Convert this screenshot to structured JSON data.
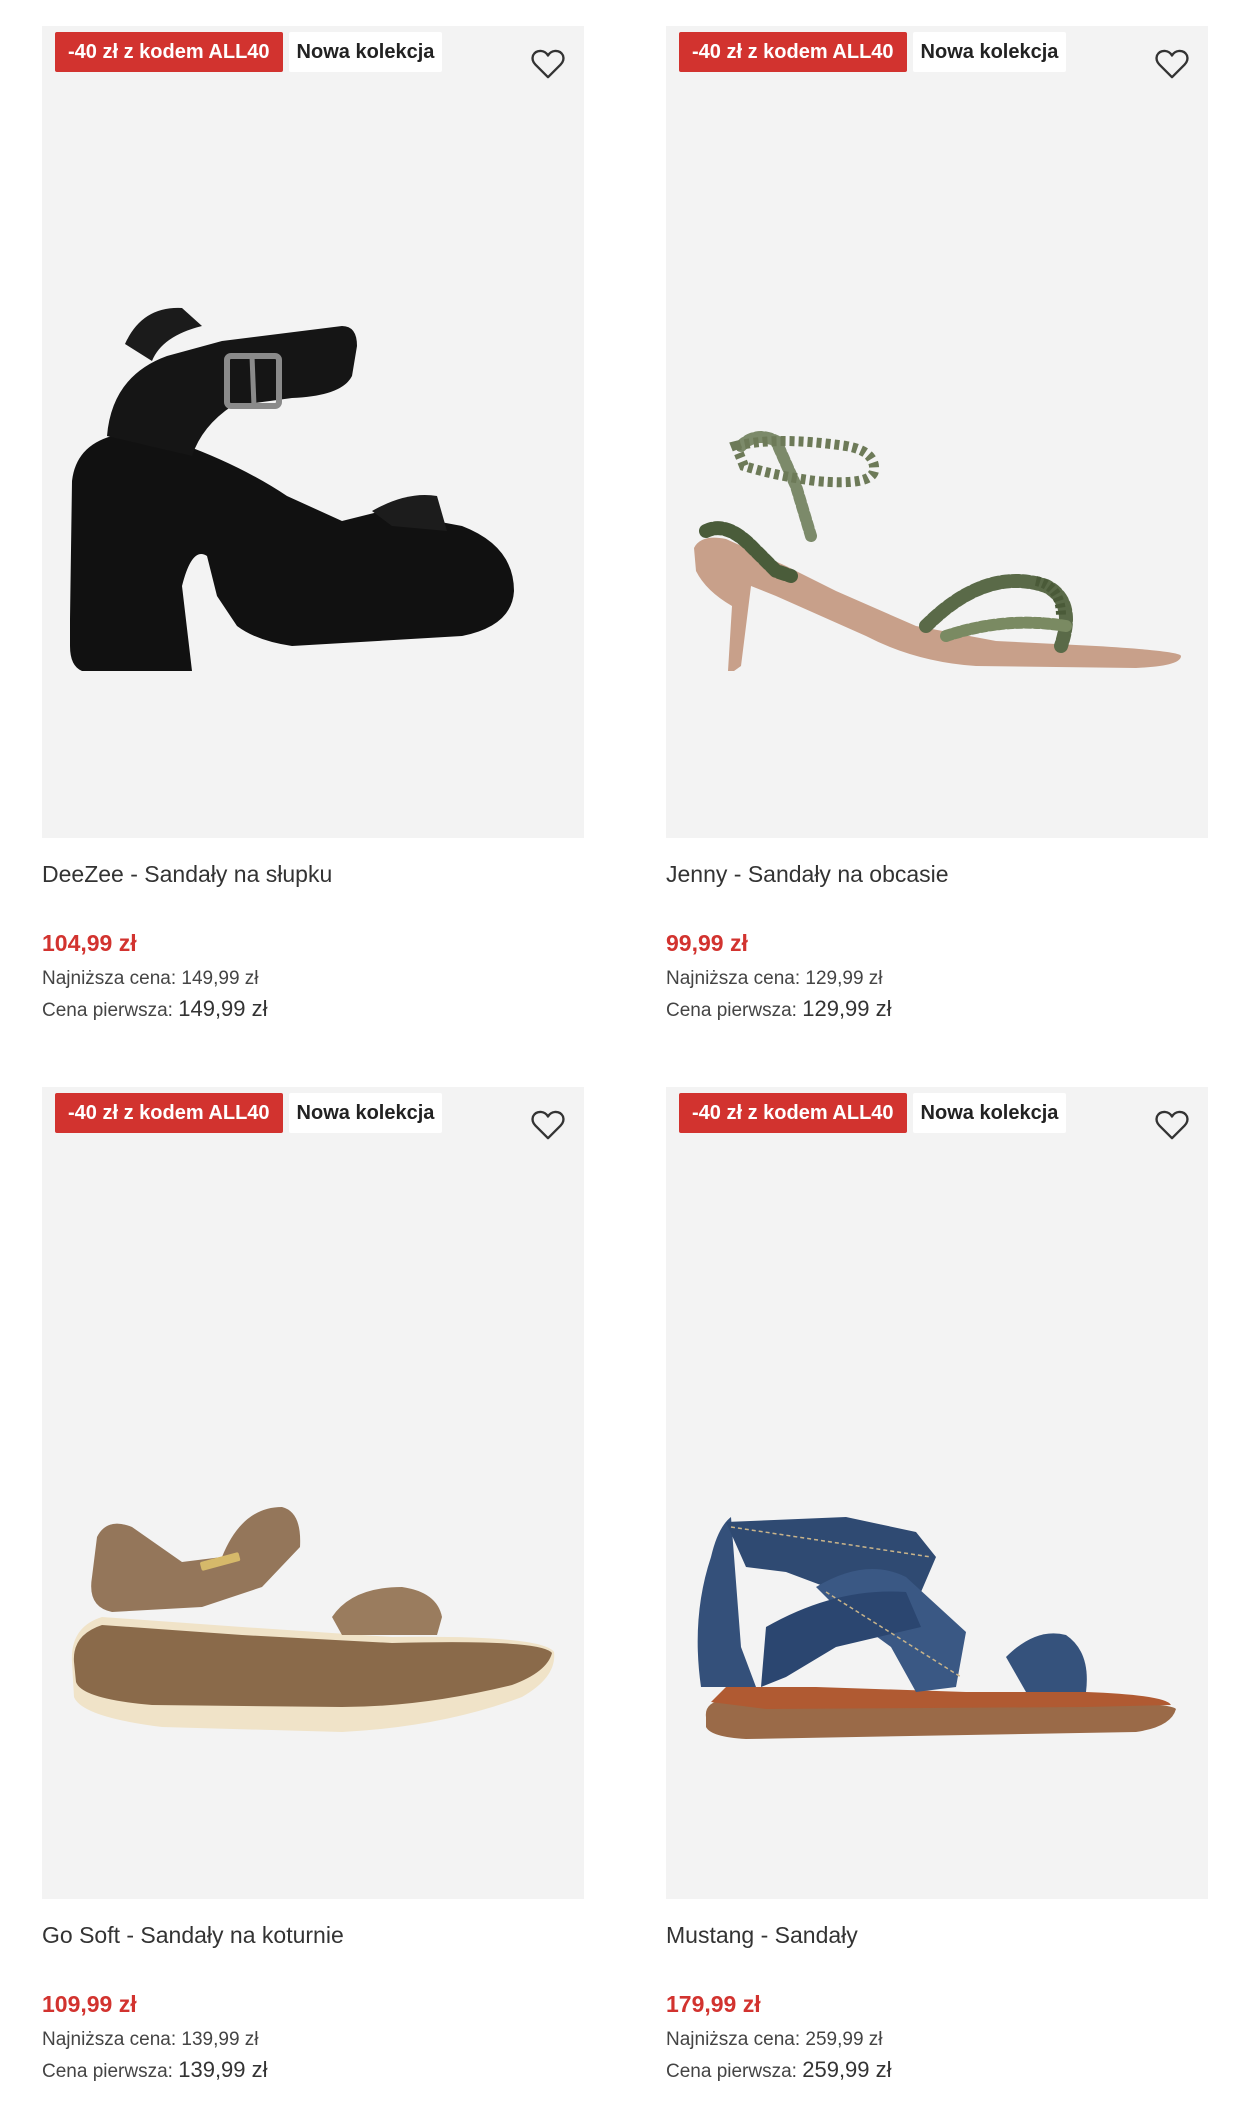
{
  "products": [
    {
      "promo_badge": "-40 zł z kodem ALL40",
      "new_badge": "Nowa kolekcja",
      "title": "DeeZee - Sandały na słupku",
      "price": "104,99 zł",
      "lowest_label": "Najniższa cena:",
      "lowest_value": "149,99 zł",
      "first_label": "Cena pierwsza:",
      "first_value": "149,99 zł",
      "image_icon": "black-platform-sandal"
    },
    {
      "promo_badge": "-40 zł z kodem ALL40",
      "new_badge": "Nowa kolekcja",
      "title": "Jenny - Sandały na obcasie",
      "price": "99,99 zł",
      "lowest_label": "Najniższa cena:",
      "lowest_value": "129,99 zł",
      "first_label": "Cena pierwsza:",
      "first_value": "129,99 zł",
      "image_icon": "snakeskin-kitten-heel-sandal"
    },
    {
      "promo_badge": "-40 zł z kodem ALL40",
      "new_badge": "Nowa kolekcja",
      "title": "Go Soft - Sandały na koturnie",
      "price": "109,99 zł",
      "lowest_label": "Najniższa cena:",
      "lowest_value": "139,99 zł",
      "first_label": "Cena pierwsza:",
      "first_value": "139,99 zł",
      "image_icon": "brown-wedge-sandal"
    },
    {
      "promo_badge": "-40 zł z kodem ALL40",
      "new_badge": "Nowa kolekcja",
      "title": "Mustang - Sandały",
      "price": "179,99 zł",
      "lowest_label": "Najniższa cena:",
      "lowest_value": "259,99 zł",
      "first_label": "Cena pierwsza:",
      "first_value": "259,99 zł",
      "image_icon": "denim-flat-sandal"
    }
  ],
  "colors": {
    "promo_red": "#d2332f",
    "image_background": "#f3f3f3"
  },
  "icons": {
    "favorite": "heart-outline-icon"
  }
}
